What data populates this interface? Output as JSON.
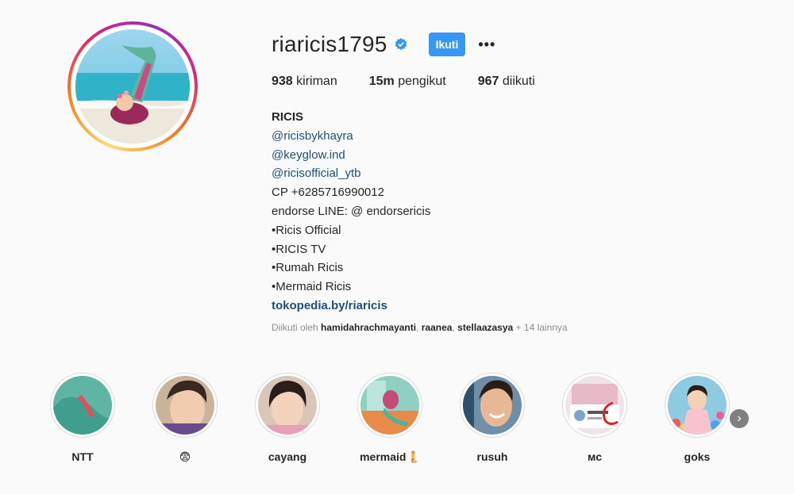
{
  "profile": {
    "username": "riaricis1795",
    "follow_label": "Ikuti",
    "more_label": "•••",
    "stats": {
      "posts_value": "938",
      "posts_label": "kiriman",
      "followers_value": "15m",
      "followers_label": "pengikut",
      "following_value": "967",
      "following_label": "diikuti"
    },
    "bio": {
      "name": "RICIS",
      "mention1": "@ricisbykhayra",
      "mention2": "@keyglow.ind",
      "mention3": "@ricisofficial_ytb",
      "line_cp": "CP +6285716990012",
      "line_endorse": "endorse LINE: @ endorsericis",
      "line_official": "•Ricis Official",
      "line_tv": "•RICIS TV",
      "line_rumah": "•Rumah Ricis",
      "line_mermaid": "•Mermaid Ricis",
      "website": "tokopedia.by/riaricis"
    },
    "followed_by": {
      "prefix": "Diikuti oleh",
      "user1": "hamidahrachmayanti",
      "sep1": ", ",
      "user2": "raanea",
      "sep2": ", ",
      "user3": "stellaazasya",
      "suffix": "+ 14 lainnya"
    }
  },
  "highlights": [
    {
      "label": "NTT"
    },
    {
      "label": "😨"
    },
    {
      "label": "cayang"
    },
    {
      "label": "mermaid🧜"
    },
    {
      "label": "rusuh"
    },
    {
      "label": "мс"
    },
    {
      "label": "goks"
    }
  ],
  "colors": {
    "follow_button": "#3897f0",
    "link": "#1e4f7f",
    "verified": "#3897f0"
  },
  "icons": {
    "verified": "verified-badge-icon",
    "more": "more-options-icon",
    "next": "chevron-right-icon"
  }
}
